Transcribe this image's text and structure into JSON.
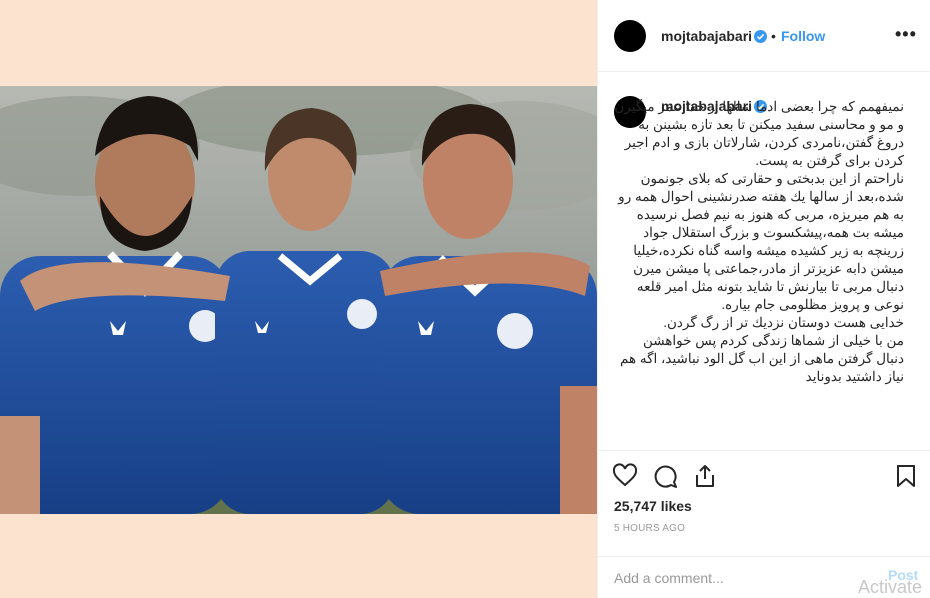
{
  "post": {
    "username": "mojtabajabari",
    "verified_icon": "verified-badge-icon",
    "separator": "•",
    "follow_label": "Follow",
    "more_icon": "more-options-icon"
  },
  "caption": {
    "username": "mojtabajabari",
    "text": "نمیفهمم که چرا بعضی ادما سالها از خدا عمر میگیرن و مو و محاسنی سفید میکنن تا بعد تازه بشینن به دروغ گفتن،نامردی کردن، شارلاتان بازی و ادم اجیر کردن برای گرفتن به پست.\nناراحتم از این بدبختی و حقارتی که بلای جونمون شده،بعد از سالها یك هفته صدرنشینی احوال همه رو به هم میریزه، مربی که هنوز به نیم فصل نرسیده میشه بت همه،پیشکسوت و بزرگ استقلال جواد زرینچه به زیر کشیده میشه واسه گناه نکرده،خیلیا میشن دابه عزیزتر از مادر،جماعتی پا میشن میرن دنبال مربی تا بیارنش تا شاید بتونه مثل امیر قلعه نوعی و پرویز مظلومی جام بیاره.\nخدایی هست دوستان نزدیك تر از رگ گردن.\nمن با خیلی از شماها زندگی کردم پس خواهشن دنبال گرفتن ماهی از این اب گل الود نباشید، اگه هم نیاز داشتید بدوناید"
  },
  "actions": {
    "like_icon": "heart-icon",
    "comment_icon": "comment-icon",
    "share_icon": "share-icon",
    "save_icon": "bookmark-icon"
  },
  "likes_text": "25,747 likes",
  "timestamp": "5 HOURS AGO",
  "add_comment": {
    "placeholder": "Add a comment...",
    "post_label": "Post"
  },
  "watermark": "Activate",
  "colors": {
    "accent": "#3897f0",
    "post_disabled": "#b3dbff",
    "photo_background": "#fbe3d0",
    "jersey_blue": "#1f4fa0"
  }
}
